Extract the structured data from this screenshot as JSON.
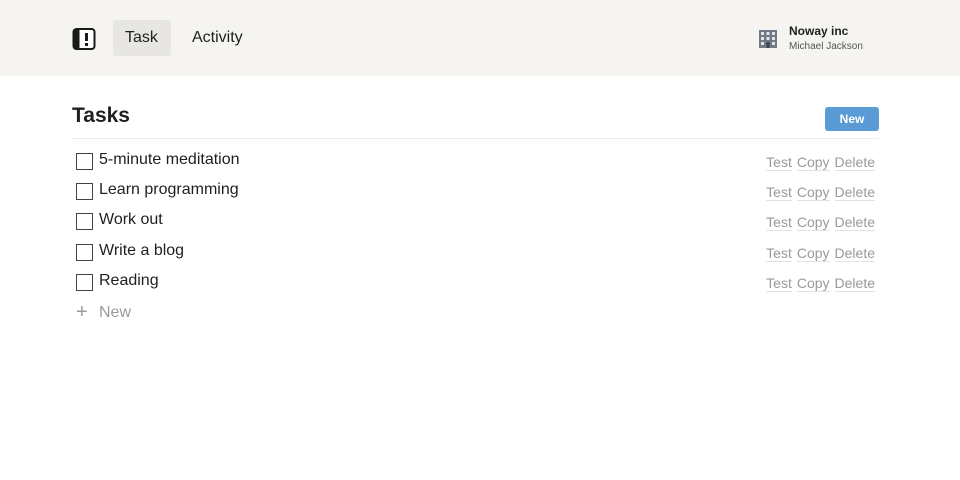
{
  "header": {
    "nav": [
      {
        "label": "Task",
        "active": true
      },
      {
        "label": "Activity",
        "active": false
      }
    ],
    "account": {
      "org": "Noway inc",
      "user": "Michael Jackson"
    }
  },
  "main": {
    "title": "Tasks",
    "new_button_label": "New",
    "tasks": [
      {
        "name": "5-minute meditation",
        "checked": false
      },
      {
        "name": "Learn programming",
        "checked": false
      },
      {
        "name": "Work out",
        "checked": false
      },
      {
        "name": "Write a blog",
        "checked": false
      },
      {
        "name": "Reading",
        "checked": false
      }
    ],
    "row_actions": [
      "Test",
      "Copy",
      "Delete"
    ],
    "add_label": "New",
    "add_icon": "plus-icon"
  },
  "colors": {
    "header_bg": "#f5f4f0",
    "active_tab_bg": "#e7e6e2",
    "primary_button": "#5a9bd6",
    "muted_text": "#9a9a9a"
  }
}
